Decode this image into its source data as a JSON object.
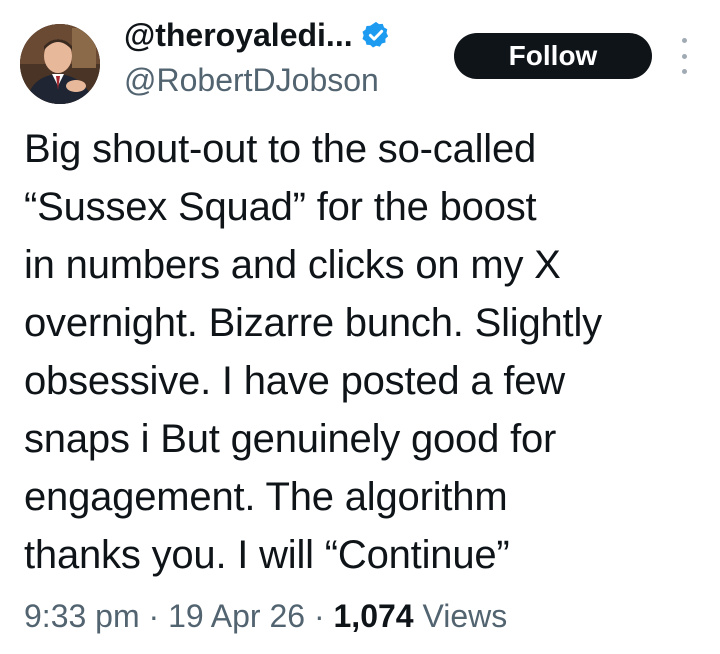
{
  "author": {
    "display_name": "@theroyaledi...",
    "handle": "@RobertDJobson",
    "verified": true,
    "verified_color": "#1d9bf0"
  },
  "actions": {
    "follow_label": "Follow",
    "more_icon": "vertical-dots"
  },
  "tweet": {
    "lines": [
      "Big shout-out to the so-called",
      "“Sussex Squad” for the boost",
      "in numbers and clicks on my X",
      "overnight. Bizarre bunch. Slightly",
      "obsessive. I have posted a few",
      "snaps i But genuinely good for",
      "engagement. The algorithm",
      "thanks you. I will “Continue”"
    ]
  },
  "meta": {
    "time": "9:33 pm",
    "separator": "·",
    "date": "19 Apr 26",
    "views_count": "1,074",
    "views_label": "Views"
  },
  "colors": {
    "text_primary": "#0f1419",
    "text_secondary": "#536471",
    "follow_bg": "#0f1419",
    "follow_text": "#ffffff"
  }
}
